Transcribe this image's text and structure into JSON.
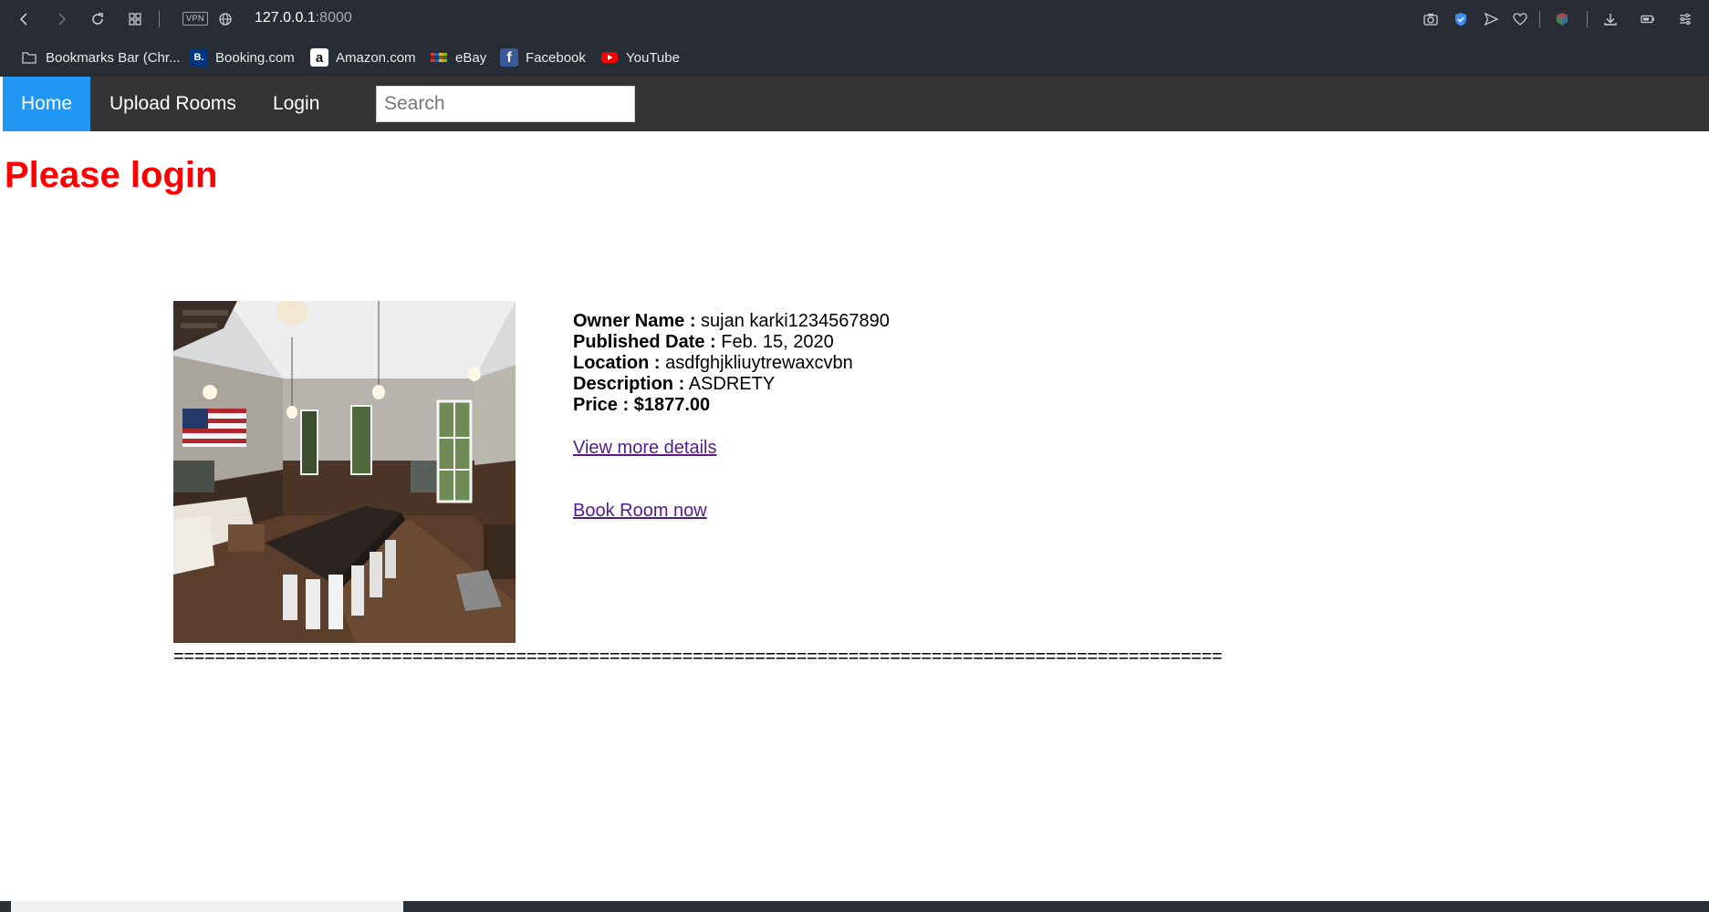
{
  "browser": {
    "url_host": "127.0.0.1",
    "url_port": ":8000",
    "vpn_label": "VPN",
    "bookmarks": [
      {
        "label": "Bookmarks Bar (Chr...",
        "icon": "folder-icon"
      },
      {
        "label": "Booking.com",
        "icon": "booking-icon",
        "icon_text": "B.",
        "color": "#003580"
      },
      {
        "label": "Amazon.com",
        "icon": "amazon-icon",
        "icon_text": "a",
        "color": "#ffffff"
      },
      {
        "label": "eBay",
        "icon": "ebay-icon"
      },
      {
        "label": "Facebook",
        "icon": "facebook-icon",
        "icon_text": "f",
        "color": "#3b5998"
      },
      {
        "label": "YouTube",
        "icon": "youtube-icon",
        "color": "#ff0000"
      }
    ]
  },
  "nav": {
    "home": "Home",
    "upload": "Upload Rooms",
    "login": "Login",
    "search_placeholder": "Search",
    "active_color": "#2196f3"
  },
  "alert": {
    "text": "Please login",
    "color": "#ff0000"
  },
  "room": {
    "owner_label": "Owner Name :",
    "owner_value": "sujan karki1234567890",
    "date_label": "Published Date :",
    "date_value": "Feb. 15, 2020",
    "location_label": "Location :",
    "location_value": "asdfghjkliuytrewaxcvbn",
    "description_label": "Description :",
    "description_value": "ASDRETY",
    "price_label": "Price :",
    "price_value": "$1877.00",
    "view_link": "View more details",
    "book_link": "Book Room now"
  },
  "separator": "====================================================================================================="
}
